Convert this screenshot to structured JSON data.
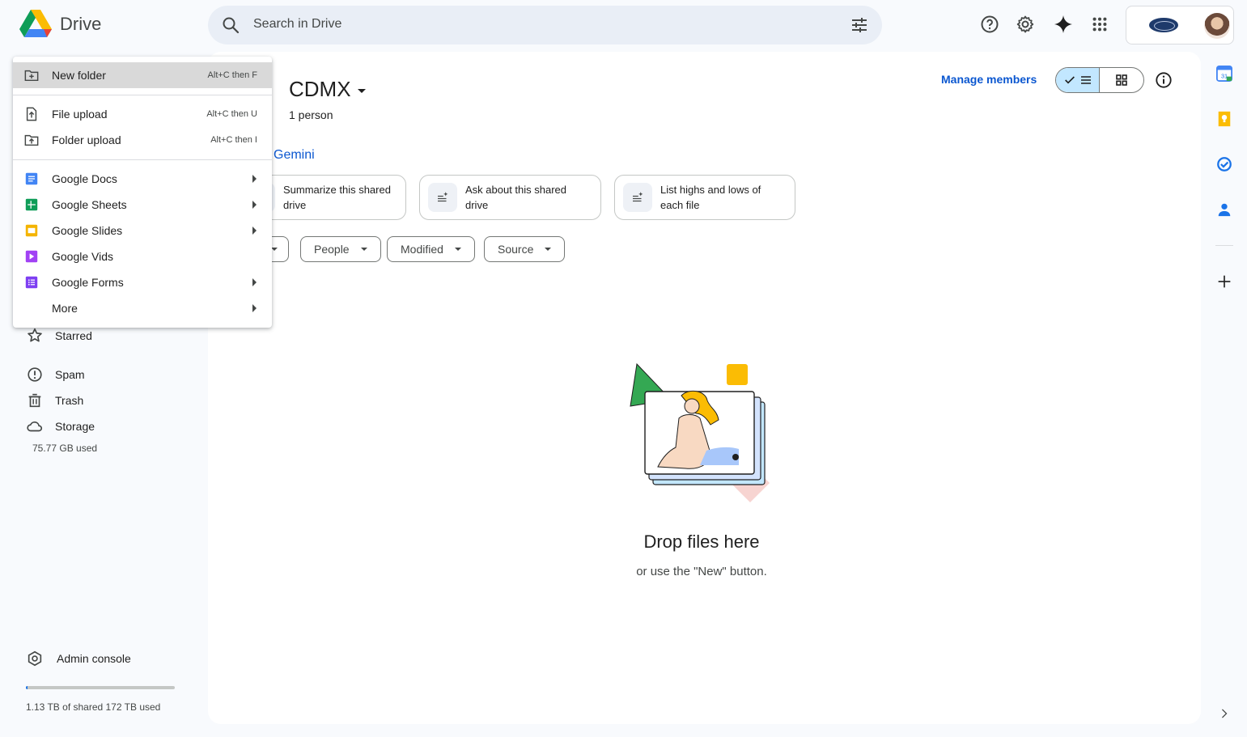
{
  "app": {
    "name": "Drive"
  },
  "search": {
    "placeholder": "Search in Drive"
  },
  "header_icons": [
    "help-icon",
    "settings-icon",
    "gemini-spark-icon",
    "apps-grid-icon"
  ],
  "nav": {
    "starred": "Starred",
    "spam": "Spam",
    "trash": "Trash",
    "storage": "Storage",
    "storage_used": "75.77 GB used",
    "admin_console": "Admin console",
    "shared_storage_text": "1.13 TB of shared 172 TB used",
    "shared_storage_fraction": 0.0066
  },
  "drive": {
    "title": "CDMX",
    "members": "1 person",
    "manage_members": "Manage members",
    "view_mode": "list"
  },
  "gemini": {
    "label": "Gemini",
    "suggestions": [
      {
        "text": "Summarize this shared drive"
      },
      {
        "text": "Ask about this shared drive"
      },
      {
        "text": "List highs and lows of each file"
      }
    ]
  },
  "filters": [
    {
      "label": ""
    },
    {
      "label": "People"
    },
    {
      "label": "Modified"
    },
    {
      "label": "Source"
    }
  ],
  "empty_state": {
    "title": "Drop files here",
    "subtitle": "or use the \"New\" button."
  },
  "new_menu": {
    "new_folder": {
      "label": "New folder",
      "shortcut": "Alt+C then F"
    },
    "file_upload": {
      "label": "File upload",
      "shortcut": "Alt+C then U"
    },
    "folder_upload": {
      "label": "Folder upload",
      "shortcut": "Alt+C then I"
    },
    "google_docs": {
      "label": "Google Docs"
    },
    "google_sheets": {
      "label": "Google Sheets"
    },
    "google_slides": {
      "label": "Google Slides"
    },
    "google_vids": {
      "label": "Google Vids"
    },
    "google_forms": {
      "label": "Google Forms"
    },
    "more": {
      "label": "More"
    }
  },
  "side_panel": {
    "calendar_date": "31",
    "icons": [
      "calendar-icon",
      "keep-icon",
      "tasks-icon",
      "contacts-icon",
      "add-icon",
      "expand-panel-icon"
    ]
  },
  "colors": {
    "accent": "#0b57d0",
    "search_bg": "#e9eef6",
    "docs": "#4285f4",
    "sheets": "#0f9d58",
    "slides": "#f4b400",
    "vids": "#a142f4",
    "forms": "#7e3ff2"
  }
}
